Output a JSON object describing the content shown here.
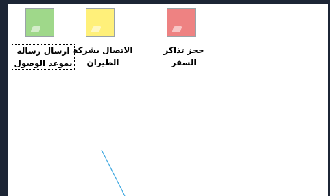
{
  "desktop": {
    "items": [
      {
        "label": "ارسال رسالة\nبموعد الوصول",
        "icon": "green-note-icon",
        "color": "#9fd88a",
        "selected": true
      },
      {
        "label": "الاتصال بشركة\nالطيران",
        "icon": "yellow-note-icon",
        "color": "#fff07a",
        "selected": false
      },
      {
        "label": "حجز تذاكر\nالسفر",
        "icon": "red-note-icon",
        "color": "#ee8282",
        "selected": false
      }
    ]
  },
  "colors": {
    "frame": "#1c2535",
    "line": "#3aa6e0"
  }
}
